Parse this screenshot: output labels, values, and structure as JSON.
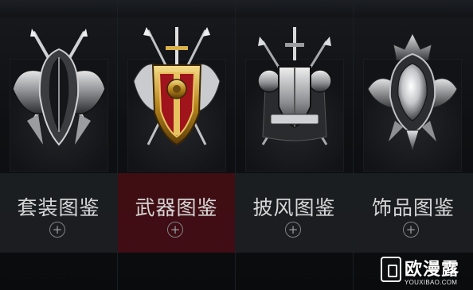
{
  "columns": [
    {
      "title": "套装图鉴",
      "plus": "+",
      "active": false
    },
    {
      "title": "武器图鉴",
      "plus": "+",
      "active": true
    },
    {
      "title": "披风图鉴",
      "plus": "+",
      "active": false
    },
    {
      "title": "饰品图鉴",
      "plus": "+",
      "active": false
    }
  ],
  "watermark": {
    "brand": "欧漫露",
    "url": "YOUXIBAO.COM"
  },
  "colors": {
    "active_panel": "#4e0e14",
    "panel": "#202226",
    "text": "#d6d6d6"
  }
}
